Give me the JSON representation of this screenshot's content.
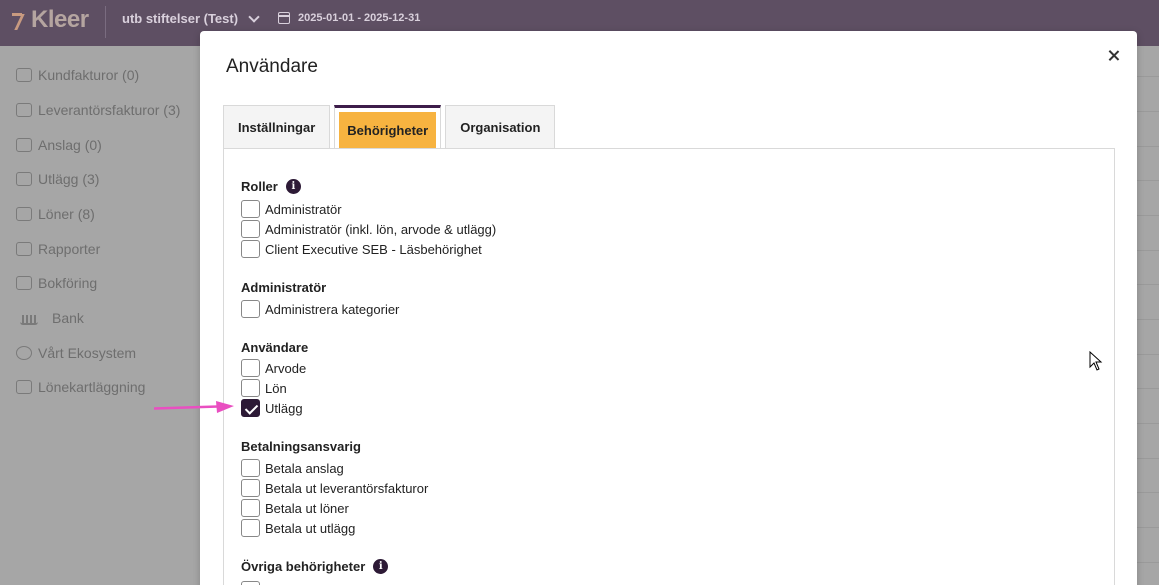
{
  "app": {
    "logo": "Kleer",
    "org": "utb stiftelser (Test)",
    "period": "2025-01-01 - 2025-12-31"
  },
  "sidebar": {
    "items": [
      {
        "label": "Kundfakturor  (0)"
      },
      {
        "label": "Leverantörsfakturor  (3)"
      },
      {
        "label": "Anslag  (0)"
      },
      {
        "label": "Utlägg  (3)"
      },
      {
        "label": "Löner  (8)"
      },
      {
        "label": "Rapporter"
      },
      {
        "label": "Bokföring"
      },
      {
        "label": "Bank"
      },
      {
        "label": "Vårt Ekosystem"
      },
      {
        "label": "Lönekartläggning"
      }
    ]
  },
  "modal": {
    "title": "Användare",
    "tabs": [
      {
        "label": "Inställningar",
        "active": false
      },
      {
        "label": "Behörigheter",
        "active": true
      },
      {
        "label": "Organisation",
        "active": false
      }
    ],
    "sections": {
      "roller": {
        "title": "Roller",
        "items": [
          {
            "label": "Administratör",
            "checked": false
          },
          {
            "label": "Administratör (inkl. lön, arvode & utlägg)",
            "checked": false
          },
          {
            "label": "Client Executive SEB - Läsbehörighet",
            "checked": false
          }
        ]
      },
      "administrator": {
        "title": "Administratör",
        "items": [
          {
            "label": "Administrera kategorier",
            "checked": false
          }
        ]
      },
      "anvandare": {
        "title": "Användare",
        "items": [
          {
            "label": "Arvode",
            "checked": false
          },
          {
            "label": "Lön",
            "checked": false
          },
          {
            "label": "Utlägg",
            "checked": true
          }
        ]
      },
      "betalning": {
        "title": "Betalningsansvarig",
        "items": [
          {
            "label": "Betala anslag",
            "checked": false
          },
          {
            "label": "Betala ut leverantörsfakturor",
            "checked": false
          },
          {
            "label": "Betala ut löner",
            "checked": false
          },
          {
            "label": "Betala ut utlägg",
            "checked": false
          }
        ]
      },
      "ovriga": {
        "title": "Övriga behörigheter"
      }
    }
  },
  "colors": {
    "topbar": "#5e4f63",
    "accent_tab": "#f7b340",
    "primary_dark": "#2d1a36",
    "annotation_arrow": "#e94fc1"
  }
}
